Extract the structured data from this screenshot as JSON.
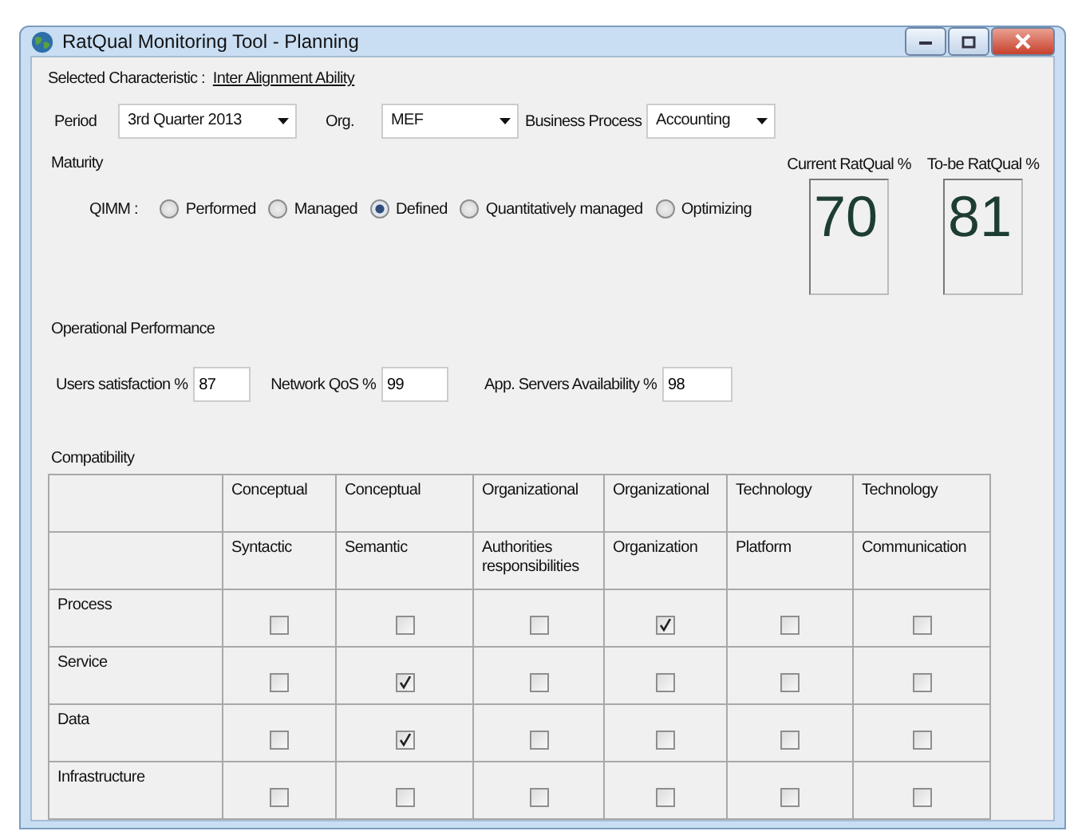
{
  "window": {
    "title": "RatQual Monitoring Tool - Planning"
  },
  "selected_characteristic": {
    "label": "Selected Characteristic :",
    "value": "Inter Alignment Ability"
  },
  "dropdowns": [
    {
      "label": "Period",
      "value": "3rd  Quarter 2013"
    },
    {
      "label": "Org.",
      "value": "MEF"
    },
    {
      "label": "Business Process",
      "value": "Accounting"
    }
  ],
  "maturity": {
    "title": "Maturity",
    "label": "QIMM :",
    "options": [
      {
        "label": "Performed",
        "selected": false
      },
      {
        "label": "Managed",
        "selected": false
      },
      {
        "label": "Defined",
        "selected": true
      },
      {
        "label": "Quantitatively managed",
        "selected": false
      },
      {
        "label": "Optimizing",
        "selected": false
      }
    ]
  },
  "ratqual": [
    {
      "label": "Current RatQual %",
      "value": "70"
    },
    {
      "label": "To-be RatQual %",
      "value": "81"
    }
  ],
  "operational_performance": {
    "title": "Operational Performance",
    "fields": [
      {
        "label": "Users satisfaction %",
        "value": "87"
      },
      {
        "label": "Network QoS %",
        "value": "99"
      },
      {
        "label": "App. Servers Availability %",
        "value": "98"
      }
    ]
  },
  "compatibility": {
    "title": "Compatibility",
    "columns": [
      {
        "group": "Conceptual",
        "name": "Syntactic"
      },
      {
        "group": "Conceptual",
        "name": "Semantic"
      },
      {
        "group": "Organizational",
        "name": "Authorities responsibilities"
      },
      {
        "group": "Organizational",
        "name": "Organization"
      },
      {
        "group": "Technology",
        "name": "Platform"
      },
      {
        "group": "Technology",
        "name": "Communication"
      }
    ],
    "rows": [
      {
        "name": "Process",
        "cells": [
          {
            "checked": false
          },
          {
            "checked": false
          },
          {
            "checked": false
          },
          {
            "checked": true
          },
          {
            "checked": false
          },
          {
            "checked": false
          }
        ]
      },
      {
        "name": "Service",
        "cells": [
          {
            "checked": false
          },
          {
            "checked": true
          },
          {
            "checked": false
          },
          {
            "checked": false
          },
          {
            "checked": false
          },
          {
            "checked": false
          }
        ]
      },
      {
        "name": "Data",
        "cells": [
          {
            "checked": false
          },
          {
            "checked": true
          },
          {
            "checked": false
          },
          {
            "checked": false
          },
          {
            "checked": false
          },
          {
            "checked": false
          }
        ]
      },
      {
        "name": "Infrastructure",
        "cells": [
          {
            "checked": false
          },
          {
            "checked": false
          },
          {
            "checked": false
          },
          {
            "checked": false
          },
          {
            "checked": false
          },
          {
            "checked": false
          }
        ]
      }
    ]
  }
}
